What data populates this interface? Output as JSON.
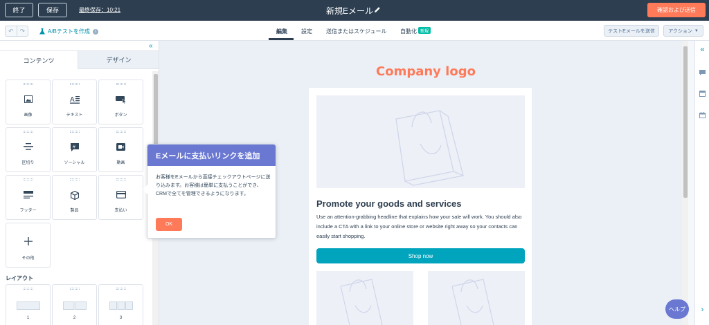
{
  "topbar": {
    "exit_label": "終了",
    "save_label": "保存",
    "last_saved": "最終保存：10:21",
    "email_title": "新規Eメール",
    "send_label": "確認および送信"
  },
  "subbar": {
    "ab_test_label": "A/Bテストを作成",
    "tabs": [
      "編集",
      "設定",
      "送信またはスケジュール",
      "自動化"
    ],
    "new_badge": "新規",
    "test_email_label": "テストEメールを送信",
    "actions_label": "アクション"
  },
  "panel": {
    "tabs": [
      "コンテンツ",
      "デザイン"
    ],
    "modules": [
      {
        "label": "画像",
        "icon": "image-icon"
      },
      {
        "label": "テキスト",
        "icon": "text-icon"
      },
      {
        "label": "ボタン",
        "icon": "button-icon"
      },
      {
        "label": "区切り",
        "icon": "divider-icon"
      },
      {
        "label": "ソーシャル",
        "icon": "social-icon"
      },
      {
        "label": "動画",
        "icon": "video-icon"
      },
      {
        "label": "フッター",
        "icon": "footer-icon"
      },
      {
        "label": "製品",
        "icon": "product-icon"
      },
      {
        "label": "支払い",
        "icon": "payment-icon"
      },
      {
        "label": "その他",
        "icon": "plus-icon"
      }
    ],
    "layout_title": "レイアウト",
    "layouts": [
      "1",
      "2",
      "3"
    ]
  },
  "tooltip": {
    "title": "Eメールに支払いリンクを追加",
    "body": "お客様をEメールから直接チェックアウトページに送り込みます。お客様は簡単に支払うことができ、CRMで全てを管理できるようになります。",
    "ok_label": "OK"
  },
  "email": {
    "logo_text": "Company logo",
    "heading": "Promote your goods and services",
    "body": "Use an attention-grabbing headline that explains how your sale will work. You should also include a CTA with a link to your online store or website right away so your contacts can easily start shopping.",
    "cta_label": "Shop now"
  },
  "help_label": "ヘルプ",
  "colors": {
    "topbar": "#2d3e50",
    "accent": "#ff7a59",
    "tooltip_header": "#6a78d1",
    "cta": "#00a4bd",
    "badge": "#00bda5"
  }
}
